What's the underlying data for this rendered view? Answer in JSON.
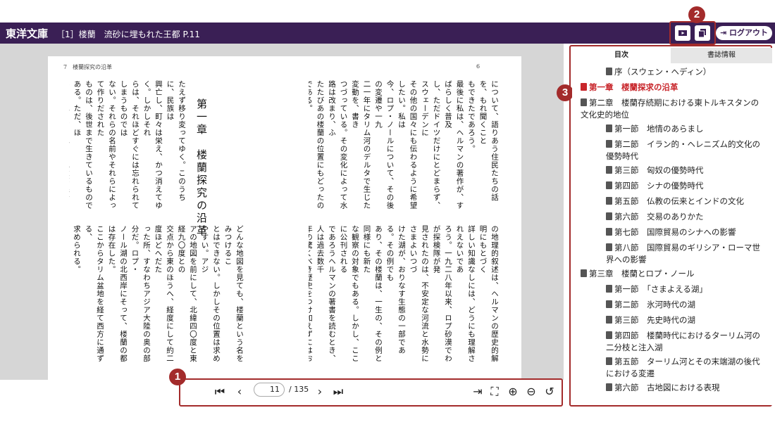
{
  "header": {
    "brand": "東洋文庫",
    "doc_title": "［1］楼蘭　流砂に埋もれた王都 P.11",
    "logout_label": "ログアウト",
    "icons": [
      "slideshow-icon",
      "copy-icon"
    ]
  },
  "callouts": {
    "b1": "1",
    "b2": "2",
    "b3": "3"
  },
  "book": {
    "left_header": "7　楼蘭探究の沿革",
    "right_header": "6",
    "chapter_title": "第一章　楼蘭探究の沿革",
    "left_top_cols": [
      "たえず移り変ってゆく。このうちに、民族は",
      "興亡し、町々は栄え、かつ消えてゆく。しかしそれ",
      "らは、それほどすぐには忘れられてしまうものでは",
      "ない。それらの名前やそれらによって作りだされた",
      "ものは、後世まで生きているものである。ただ、ほ",
      "んのまれに、それらの記憶が完全に消えうせてし",
      "まい、やっと幸運な偶然のおかげで、失われたもの",
      "が考古学の手によりもどされる、ということがおこ",
      "る。そのよい例が楼蘭なのだ。ここは、かつては",
      "古代の「絹の道」に沿う主要な都市であり、七〇年",
      "ほどの間は、シナ勢力の西方基地になっていた。"
    ],
    "left_bottom_cols": [
      "どんな地図を見ても、楼蘭という名をみつけるこ",
      "とはできない。しかしその位置は求めやすい。アジ",
      "アの地図を前にして、北緯四〇度と東経九〇度との",
      "交点から東のほうへ、経度にして約二度ほどへだた",
      "った所、すなわちアジア大陸の奥の部分だ。ロプ・",
      "ノール湖の北西岸にそって、楼蘭の都は存在した。",
      "ここからタリム盆地を経て西方に通ずる、",
      "求められる。",
      "楼蘭がマークされるこの土地は、そこを流れてい",
      "る主要な河の名にちなんでタリム盆地と呼ばれ、",
      "また、その土地を占めている主要な住民の名にちな",
      "んで東トルキスタン（チュルク人の土地）といわれ",
      "ている。新疆という中国の一行政区（現在の新疆",
      "ウイグル自治区）の南半分を形成している。シナの",
      "出先の官憲たちは、彼らの地図と微税簿を通して、"
    ],
    "right_top_cols": [
      "について、語りあう住民たちの話を、もれ聞くこと",
      "もできたであろう。",
      "最後に私は、ヘルマンの著作が、すばらしく普及",
      "し、ただドイツだけにとどまらず、スウェーデンに",
      "その他の国々にも伝わるように希望したい。私は",
      "今、ロプ・ノールについて、その後の変遷や一九",
      "二一年にタリム河のデルタで生じた変動を、書き",
      "つづっている。その変化によって水路は改まり、ふ",
      "たたびあの楼蘭の位置にもどったのである。",
      "とつけ、ここに提供されるヘルマンの業績は、",
      "すぐれた学者ヘルマン博士の貴重な研究であり、",
      "えられない。彼の使った素材は、歴史学や自然地理",
      "学である。私のもとに、もっぱら場所や地位につい",
      "ての実際見聞にもとづく、われわれの研究は、",
      "いただいへん密接な関連をもち、楼蘭やロプ・ノー",
      "ルについて、相互に補いあうものである。私"
    ],
    "right_bottom_cols": [
      "の地理的叙述は、ヘルマンの歴史的解明にもとづく",
      "詳しい知識なしには、どうにも理解されえないであ",
      "ろう。一九二八年以来、ロプ砂漠でわが探検隊が発",
      "見されたのは、不安定な河流と水勢にさまよいつづ",
      "けた湖が、おりなす生態の一部である。その例でも",
      "あり、その楼蘭は、一生の、その例と同様にも新た",
      "な観察の対象でもある。しかし、ここに公刊される",
      "であろうヘルマンの著書を読むとき、人は過去数千",
      "年の驚くべき歴史をつけ加えずにはおれない",
      "う。",
      "一九三一年四月十一日、ストックホルムにて",
      "スウェン・ヘディン"
    ]
  },
  "pager": {
    "current_page": "11",
    "total": "/ 135",
    "icons": [
      "first-page-icon",
      "prev-page-icon",
      "next-page-icon",
      "last-page-icon",
      "fit-width-icon",
      "fullscreen-icon",
      "zoom-in-icon",
      "zoom-out-icon",
      "rotate-icon"
    ]
  },
  "sidebar": {
    "tabs": [
      "目次",
      "書誌情報"
    ],
    "toc": [
      {
        "label": "序（スウェン・ヘディン）",
        "level": 1
      },
      {
        "label": "第一章　楼蘭探求の沿革",
        "level": 0,
        "active": true
      },
      {
        "label": "第二章　楼蘭存続期における東トルキスタンの文化史的地位",
        "level": 0
      },
      {
        "label": "第一節　地情のあらまし",
        "level": 2
      },
      {
        "label": "第二節　イラン的・ヘレニズム的文化の優勢時代",
        "level": 2
      },
      {
        "label": "第三節　匈奴の優勢時代",
        "level": 2
      },
      {
        "label": "第四節　シナの優勢時代",
        "level": 2
      },
      {
        "label": "第五節　仏教の伝来とインドの文化",
        "level": 2
      },
      {
        "label": "第六節　交易のありかた",
        "level": 2
      },
      {
        "label": "第七節　国際貿易のシナへの影響",
        "level": 2
      },
      {
        "label": "第八節　国際貿易のギリシア・ローマ世界への影響",
        "level": 2
      },
      {
        "label": "第三章　楼蘭とロプ・ノール",
        "level": 0
      },
      {
        "label": "第一節　「さまよえる湖」",
        "level": 2
      },
      {
        "label": "第二節　氷河時代の湖",
        "level": 2
      },
      {
        "label": "第三節　先史時代の湖",
        "level": 2
      },
      {
        "label": "第四節　楼蘭時代におけるターリム河の二分枝と注入湖",
        "level": 2
      },
      {
        "label": "第五節　ターリム河とその末端湖の後代における変遷",
        "level": 2
      },
      {
        "label": "第六節　古地図における表現",
        "level": 2
      }
    ]
  }
}
